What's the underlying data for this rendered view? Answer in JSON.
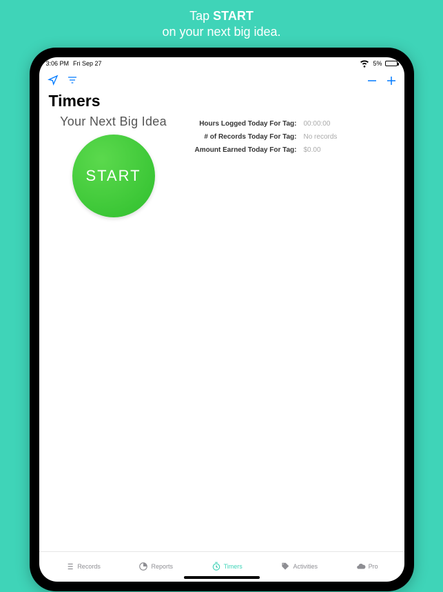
{
  "promo": {
    "line1a": "Tap ",
    "line1b": "START",
    "line2": "on your next big idea."
  },
  "status": {
    "time": "3:06 PM",
    "date": "Fri Sep 27",
    "battery_pct": "5%"
  },
  "header": {
    "title": "Timers"
  },
  "timer": {
    "idea_label": "Your Next Big Idea",
    "start_label": "START"
  },
  "stats": [
    {
      "label": "Hours Logged Today For Tag:",
      "value": "00:00:00"
    },
    {
      "label": "# of Records Today For Tag:",
      "value": "No records"
    },
    {
      "label": "Amount Earned Today For Tag:",
      "value": "$0.00"
    }
  ],
  "tabs": [
    {
      "label": "Records"
    },
    {
      "label": "Reports"
    },
    {
      "label": "Timers"
    },
    {
      "label": "Activities"
    },
    {
      "label": "Pro"
    }
  ]
}
